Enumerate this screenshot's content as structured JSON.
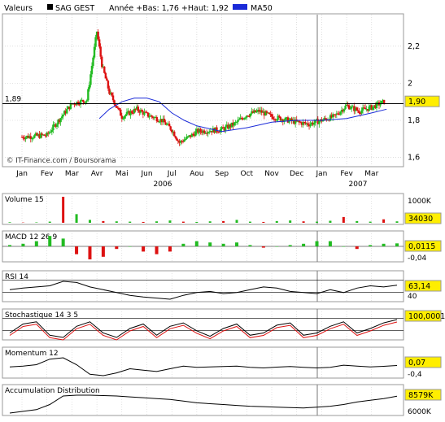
{
  "header": {
    "label": "Valeurs",
    "stock": "SAG GEST",
    "summary": "Année +Bas: 1,76 +Haut: 1,92",
    "ma_label": "MA50"
  },
  "watermark": "© IT-Finance.com / Boursorama",
  "colors": {
    "candle_up": "#22bb22",
    "candle_down": "#dd1111",
    "ma50": "#1a2ad8",
    "badge_bg": "#ffee00",
    "panel_border": "#999999",
    "grid": "#c8c8c8",
    "bar_up": "#22bb22",
    "bar_down": "#dd1111"
  },
  "chart_data": [
    {
      "type": "candlestick",
      "title": "SAG GEST",
      "x_months": [
        "Jan",
        "Fev",
        "Mar",
        "Avr",
        "Mai",
        "Jun",
        "Jul",
        "Aou",
        "Sep",
        "Oct",
        "Nov",
        "Dec",
        "Jan",
        "Fev",
        "Mar"
      ],
      "x_years": [
        "2006",
        "2007"
      ],
      "ylim": [
        1.6,
        2.35
      ],
      "yticks": [
        "2,2",
        "2",
        "1,8",
        "1,6"
      ],
      "reference_line": {
        "label": "1,89",
        "value": 1.89
      },
      "last_value_badge": "1,90",
      "series": [
        {
          "name": "Close",
          "points_month_value": [
            [
              0,
              1.71
            ],
            [
              1,
              1.72
            ],
            [
              2,
              1.89
            ],
            [
              2.6,
              1.91
            ],
            [
              3,
              2.28
            ],
            [
              3.2,
              2.1
            ],
            [
              3.5,
              1.95
            ],
            [
              4,
              1.82
            ],
            [
              4.6,
              1.86
            ],
            [
              5,
              1.83
            ],
            [
              5.6,
              1.8
            ],
            [
              6,
              1.75
            ],
            [
              6.3,
              1.68
            ],
            [
              6.8,
              1.72
            ],
            [
              7,
              1.74
            ],
            [
              8,
              1.75
            ],
            [
              8.5,
              1.78
            ],
            [
              9,
              1.83
            ],
            [
              9.5,
              1.85
            ],
            [
              10,
              1.82
            ],
            [
              11,
              1.79
            ],
            [
              11.5,
              1.78
            ],
            [
              12,
              1.8
            ],
            [
              12.5,
              1.82
            ],
            [
              13,
              1.88
            ],
            [
              13.5,
              1.85
            ],
            [
              14,
              1.87
            ],
            [
              14.5,
              1.9
            ]
          ]
        },
        {
          "name": "MA50",
          "points_month_value": [
            [
              3.1,
              1.81
            ],
            [
              3.5,
              1.86
            ],
            [
              4,
              1.9
            ],
            [
              4.5,
              1.92
            ],
            [
              5,
              1.92
            ],
            [
              5.5,
              1.9
            ],
            [
              6,
              1.84
            ],
            [
              6.5,
              1.8
            ],
            [
              7,
              1.77
            ],
            [
              8,
              1.74
            ],
            [
              9,
              1.76
            ],
            [
              10,
              1.79
            ],
            [
              11,
              1.8
            ],
            [
              12,
              1.8
            ],
            [
              13,
              1.81
            ],
            [
              14,
              1.84
            ],
            [
              14.6,
              1.86
            ]
          ]
        }
      ]
    },
    {
      "type": "bar",
      "title": "Volume 15",
      "ylabels": [
        "1000K"
      ],
      "last_value_badge": "34030",
      "values_k_approx": [
        20,
        10,
        15,
        40,
        900,
        300,
        100,
        60,
        50,
        40,
        30,
        50,
        80,
        40,
        30,
        50,
        60,
        100,
        40,
        30,
        60,
        80,
        50,
        40,
        70,
        200,
        60,
        40,
        120,
        50
      ]
    },
    {
      "type": "bar",
      "title": "MACD 12 26 9",
      "ylabels": [
        "-0,04"
      ],
      "last_value_badge": "0,0115",
      "values_approx": [
        0.005,
        0.01,
        0.02,
        0.04,
        0.03,
        -0.03,
        -0.05,
        -0.04,
        -0.01,
        0.0,
        -0.02,
        -0.03,
        -0.02,
        0.01,
        0.02,
        0.015,
        0.01,
        0.015,
        0.005,
        -0.005,
        0.0,
        0.005,
        0.01,
        0.02,
        0.02,
        0.0,
        -0.01,
        0.005,
        0.01,
        0.0115
      ]
    },
    {
      "type": "line",
      "title": "RSI 14",
      "ylabels": [
        "40"
      ],
      "last_value_badge": "63,14",
      "values_approx": [
        55,
        58,
        60,
        62,
        70,
        68,
        60,
        55,
        50,
        45,
        42,
        40,
        38,
        45,
        50,
        52,
        48,
        50,
        55,
        60,
        58,
        52,
        50,
        48,
        55,
        50,
        58,
        62,
        60,
        63.14
      ]
    },
    {
      "type": "line",
      "title": "Stochastique 14 3 5",
      "last_value_badge": "100,0001",
      "values_approx": [
        40,
        80,
        90,
        30,
        20,
        70,
        90,
        40,
        20,
        60,
        80,
        30,
        70,
        85,
        50,
        25,
        60,
        80,
        30,
        40,
        75,
        85,
        30,
        40,
        70,
        90,
        40,
        60,
        85,
        100
      ]
    },
    {
      "type": "line",
      "title": "Momentum 12",
      "ylabels": [
        "-0,4"
      ],
      "last_value_badge": "0,07",
      "values_approx": [
        0.02,
        0.05,
        0.1,
        0.3,
        0.35,
        0.1,
        -0.25,
        -0.3,
        -0.2,
        -0.05,
        -0.1,
        -0.15,
        -0.05,
        0.05,
        0.0,
        0.02,
        0.03,
        0.05,
        0.0,
        -0.02,
        0.01,
        0.03,
        0.0,
        -0.02,
        0.0,
        0.08,
        0.05,
        0.02,
        0.04,
        0.07
      ]
    },
    {
      "type": "line",
      "title": "Accumulation Distribution",
      "ylabels": [
        "6000K"
      ],
      "last_value_badge": "8579K",
      "values_k_approx": [
        6600,
        6800,
        7000,
        7600,
        8600,
        8700,
        8700,
        8650,
        8600,
        8500,
        8400,
        8300,
        8200,
        8000,
        7800,
        7700,
        7600,
        7500,
        7400,
        7350,
        7300,
        7250,
        7200,
        7300,
        7400,
        7600,
        7900,
        8100,
        8300,
        8579
      ]
    }
  ]
}
